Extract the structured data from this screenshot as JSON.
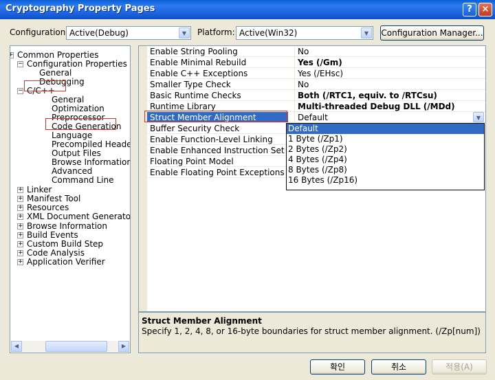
{
  "window": {
    "title": "Cryptography Property Pages",
    "help_glyph": "?",
    "close_glyph": "×"
  },
  "config_bar": {
    "configuration_label": "Configuration:",
    "configuration_value": "Active(Debug)",
    "platform_label": "Platform:",
    "platform_value": "Active(Win32)",
    "manager_button": "Configuration Manager..."
  },
  "tree": {
    "items": [
      {
        "label": "Common Properties",
        "toggle": "+"
      },
      {
        "label": "Configuration Properties",
        "toggle": "−"
      },
      {
        "label": "General"
      },
      {
        "label": "Debugging"
      },
      {
        "label": "C/C++",
        "toggle": "−"
      },
      {
        "label": "General"
      },
      {
        "label": "Optimization"
      },
      {
        "label": "Preprocessor"
      },
      {
        "label": "Code Generation"
      },
      {
        "label": "Language"
      },
      {
        "label": "Precompiled Headers"
      },
      {
        "label": "Output Files"
      },
      {
        "label": "Browse Information"
      },
      {
        "label": "Advanced"
      },
      {
        "label": "Command Line"
      },
      {
        "label": "Linker",
        "toggle": "+"
      },
      {
        "label": "Manifest Tool",
        "toggle": "+"
      },
      {
        "label": "Resources",
        "toggle": "+"
      },
      {
        "label": "XML Document Generator",
        "toggle": "+"
      },
      {
        "label": "Browse Information",
        "toggle": "+"
      },
      {
        "label": "Build Events",
        "toggle": "+"
      },
      {
        "label": "Custom Build Step",
        "toggle": "+"
      },
      {
        "label": "Code Analysis",
        "toggle": "+"
      },
      {
        "label": "Application Verifier",
        "toggle": "+"
      }
    ],
    "scroll_left": "◀",
    "scroll_right": "▶"
  },
  "properties": [
    {
      "name": "Enable String Pooling",
      "value": "No",
      "bold": false
    },
    {
      "name": "Enable Minimal Rebuild",
      "value": "Yes (/Gm)",
      "bold": true
    },
    {
      "name": "Enable C++ Exceptions",
      "value": "Yes (/EHsc)",
      "bold": false
    },
    {
      "name": "Smaller Type Check",
      "value": "No",
      "bold": false
    },
    {
      "name": "Basic Runtime Checks",
      "value": "Both (/RTC1, equiv. to /RTCsu)",
      "bold": true
    },
    {
      "name": "Runtime Library",
      "value": "Multi-threaded Debug DLL (/MDd)",
      "bold": true
    },
    {
      "name": "Struct Member Alignment",
      "value": "Default",
      "bold": false
    },
    {
      "name": "Buffer Security Check",
      "value": "",
      "bold": false
    },
    {
      "name": "Enable Function-Level Linking",
      "value": "",
      "bold": false
    },
    {
      "name": "Enable Enhanced Instruction Set",
      "value": "",
      "bold": false
    },
    {
      "name": "Floating Point Model",
      "value": "",
      "bold": false
    },
    {
      "name": "Enable Floating Point Exceptions",
      "value": "",
      "bold": false
    }
  ],
  "dropdown": {
    "options": [
      "Default",
      "1 Byte (/Zp1)",
      "2 Bytes (/Zp2)",
      "4 Bytes (/Zp4)",
      "8 Bytes (/Zp8)",
      "16 Bytes (/Zp16)"
    ],
    "selected_index": 0
  },
  "description": {
    "title": "Struct Member Alignment",
    "text": "Specify 1, 2, 4, 8, or 16-byte boundaries for struct member alignment.     (/Zp[num])"
  },
  "buttons": {
    "ok": "확인",
    "cancel": "취소",
    "apply": "적용(A)"
  },
  "colors": {
    "selection": "#316ac5",
    "annotation_red": "#d0352a",
    "title_bar": "#0a5fd6"
  },
  "icons": [
    "help-icon",
    "close-icon",
    "chevron-down-icon",
    "expand-icon",
    "collapse-icon"
  ]
}
